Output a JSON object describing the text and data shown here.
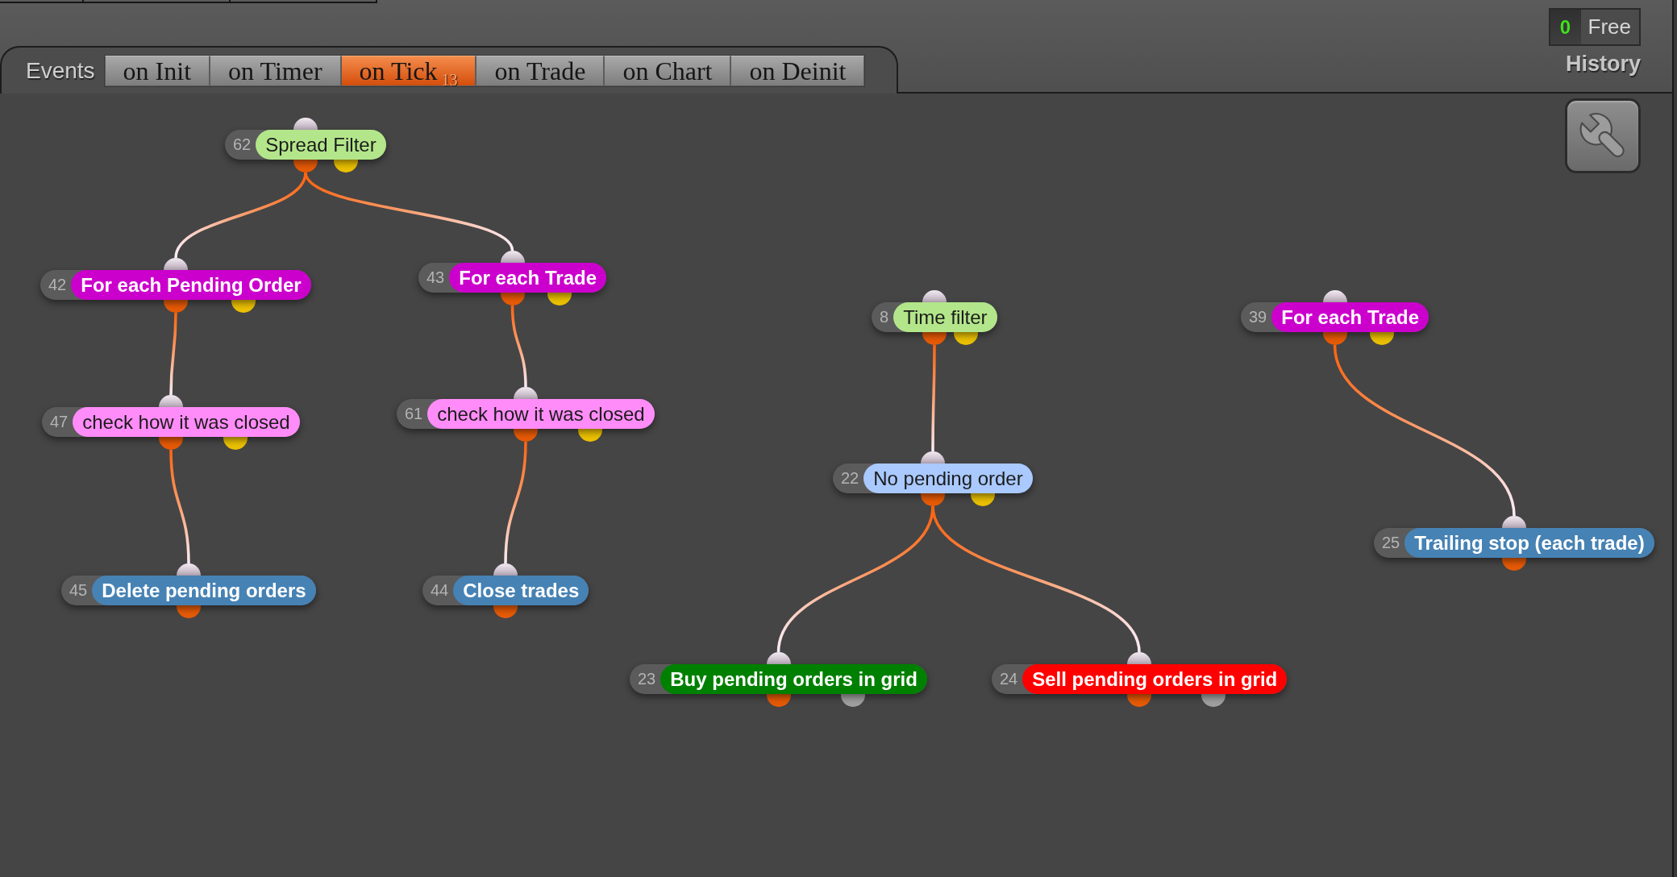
{
  "events_bar": {
    "label": "Events",
    "tabs": [
      {
        "label": "on Init",
        "selected": false
      },
      {
        "label": "on Timer",
        "selected": false
      },
      {
        "label": "on Tick",
        "selected": true,
        "count": "13"
      },
      {
        "label": "on Trade",
        "selected": false
      },
      {
        "label": "on Chart",
        "selected": false
      },
      {
        "label": "on Deinit",
        "selected": false
      }
    ]
  },
  "status_panel": {
    "free_count": "0",
    "free_label": "Free",
    "history_link": "History"
  },
  "canvas": {
    "blocks": [
      {
        "number": "62",
        "label": "Spread Filter",
        "color": "#b3e68a",
        "outputs": [
          {
            "color": "#e65a06"
          },
          {
            "color": "#eac000"
          }
        ],
        "children": [
          {
            "number": "42",
            "label": "For each Pending Order",
            "color": "#cc00cc",
            "outputs": [
              {
                "color": "#e65a06"
              },
              {
                "color": "#eac000"
              }
            ],
            "children": [
              {
                "number": "47",
                "label": "check how it was closed",
                "color": "#ff8cf8",
                "outputs": [
                  {
                    "color": "#e65a06"
                  },
                  {
                    "color": "#eac000"
                  }
                ],
                "children": [
                  {
                    "number": "45",
                    "label": "Delete pending orders",
                    "color": "#4682b4",
                    "outputs": [
                      {
                        "color": "#e65a06"
                      }
                    ]
                  }
                ]
              }
            ]
          },
          {
            "number": "43",
            "label": "For each Trade",
            "color": "#cc00cc",
            "outputs": [
              {
                "color": "#e65a06"
              },
              {
                "color": "#eac000"
              }
            ],
            "children": [
              {
                "number": "61",
                "label": "check how it was closed",
                "color": "#ff8cf8",
                "outputs": [
                  {
                    "color": "#e65a06"
                  },
                  {
                    "color": "#eac000"
                  }
                ],
                "children": [
                  {
                    "number": "44",
                    "label": "Close trades",
                    "color": "#4682b4",
                    "outputs": [
                      {
                        "color": "#e65a06"
                      }
                    ]
                  }
                ]
              }
            ]
          }
        ]
      },
      {
        "number": "8",
        "label": "Time filter",
        "color": "#b3e68a",
        "outputs": [
          {
            "color": "#e65a06"
          },
          {
            "color": "#eac000"
          }
        ],
        "children": [
          {
            "number": "22",
            "label": "No pending order",
            "color": "#a9c9ff",
            "outputs": [
              {
                "color": "#e65a06"
              },
              {
                "color": "#eac000"
              }
            ],
            "children": [
              {
                "number": "23",
                "label": "Buy pending orders in grid",
                "color": "#008000",
                "outputs": [
                  {
                    "color": "#e65a06"
                  },
                  {
                    "color": "#a0a0a0"
                  }
                ]
              },
              {
                "number": "24",
                "label": "Sell pending orders in grid",
                "color": "#ff0000",
                "outputs": [
                  {
                    "color": "#e65a06"
                  },
                  {
                    "color": "#a0a0a0"
                  }
                ]
              }
            ]
          }
        ]
      },
      {
        "number": "39",
        "label": "For each Trade",
        "color": "#cc00cc",
        "outputs": [
          {
            "color": "#e65a06"
          },
          {
            "color": "#eac000"
          }
        ],
        "children": [
          {
            "number": "25",
            "label": "Trailing stop (each trade)",
            "color": "#4682b4",
            "outputs": [
              {
                "color": "#e65a06"
              }
            ]
          }
        ]
      }
    ]
  }
}
